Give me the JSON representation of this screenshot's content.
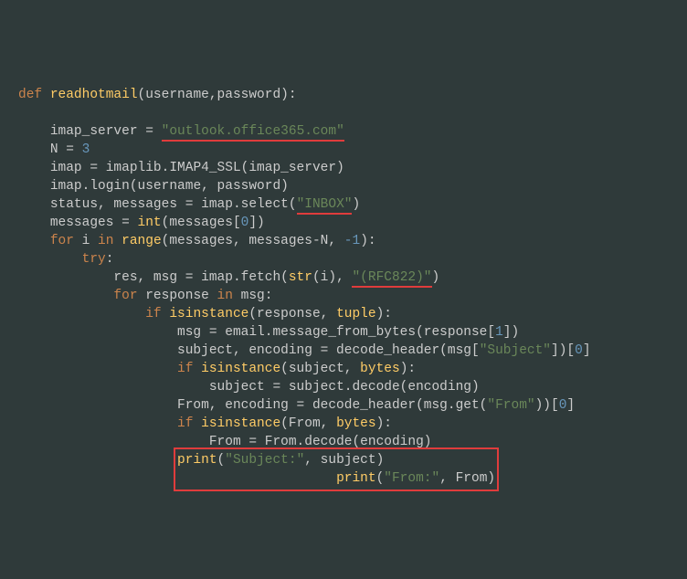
{
  "code": {
    "def": "def",
    "fn_name": "readhotmail",
    "params": "(username,password):",
    "imap_server_assign": "imap_server = ",
    "imap_server_str": "\"outlook.office365.com\"",
    "n_assign_lhs": "N = ",
    "n_assign_val": "3",
    "imap_assign": "imap = imaplib.IMAP4_SSL(imap_server)",
    "imap_login": "imap.login(username, password)",
    "status_assign_lhs": "status, messages = imap.select(",
    "inbox_str": "\"INBOX\"",
    "status_assign_rhs": ")",
    "messages_int_pre": "messages = ",
    "int_fn": "int",
    "messages_int_args": "(messages[",
    "zero": "0",
    "messages_int_close": "])",
    "for1": "for",
    "for1_mid": " i ",
    "in1": "in",
    "range_fn": " range",
    "range_args_open": "(messages, messages-N, ",
    "neg1": "-1",
    "range_args_close": "):",
    "try_kw": "try",
    "try_colon": ":",
    "res_assign_lhs": "res, msg = imap.fetch(",
    "str_fn": "str",
    "res_assign_mid": "(i), ",
    "rfc_str": "\"(RFC822)\"",
    "res_assign_close": ")",
    "for2": "for",
    "for2_mid": " response ",
    "in2": "in",
    "for2_rhs": " msg:",
    "if1": "if",
    "isinstance_fn": " isinstance",
    "isinstance1_args": "(response, ",
    "tuple_fn": "tuple",
    "isinstance1_close": "):",
    "msg_assign": "msg = email.message_from_bytes(response[",
    "one": "1",
    "msg_assign_close": "])",
    "subj_assign_lhs": "subject, encoding = decode_header(msg[",
    "subject_key": "\"Subject\"",
    "subj_assign_close": "])[",
    "zero2": "0",
    "subj_assign_end": "]",
    "if2": "if",
    "isinstance2_args": "(subject, ",
    "bytes_fn": "bytes",
    "isinstance2_close": "):",
    "subj_decode": "subject = subject.decode(encoding)",
    "from_assign_lhs": "From, encoding = decode_header(msg.get(",
    "from_key": "\"From\"",
    "from_assign_close": "))[",
    "zero3": "0",
    "from_assign_end": "]",
    "if3": "if",
    "isinstance3_args": "(From, ",
    "isinstance3_close": "):",
    "from_decode": "From = From.decode(encoding)",
    "print1_fn": "print",
    "print1_open": "(",
    "print1_str": "\"Subject:\"",
    "print1_rest": ", subject)",
    "print2_fn": "print",
    "print2_open": "(",
    "print2_str": "\"From:\"",
    "print2_rest": ", From)"
  },
  "annotations": {
    "underline1": "outlook.office365.com — underlined red",
    "underline2": "INBOX select — underlined red",
    "underline3": "(RFC822) — underlined red",
    "box1": "print Subject/From — red box"
  }
}
